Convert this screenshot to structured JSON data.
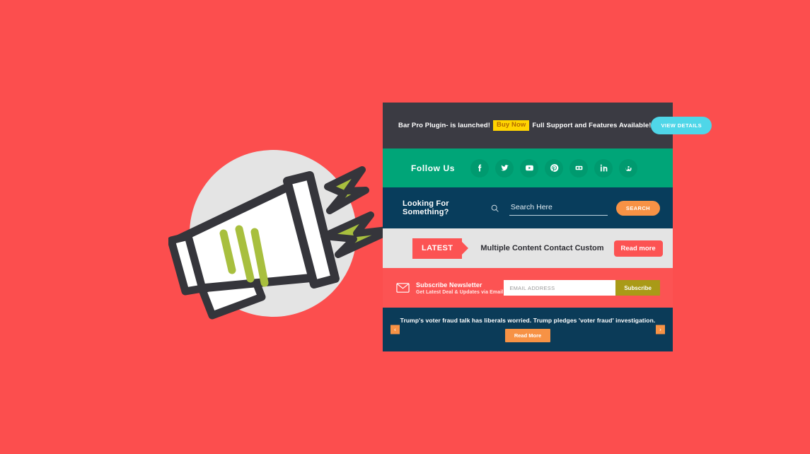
{
  "page": {
    "background_color": "#fc4e4e"
  },
  "illustration": {
    "name": "megaphone-announcement",
    "circle_color": "#e4e4e4",
    "outline_color": "#35353b",
    "body_color": "#ffffff",
    "accent_color": "#a8bf3e"
  },
  "promo_bar": {
    "background_color": "#3b3b43",
    "text_before": "Bar Pro Plugin- is launched!",
    "buy_now_label": "Buy Now",
    "buy_now_bg": "#ffd400",
    "text_after": "Full Support and Features Available!",
    "button_label": "VIEW DETAILS",
    "button_bg": "#4fd6e8"
  },
  "follow_bar": {
    "background_color": "#00a578",
    "label": "Follow Us",
    "socials": [
      {
        "name": "facebook-icon",
        "title": "Facebook"
      },
      {
        "name": "twitter-icon",
        "title": "Twitter"
      },
      {
        "name": "youtube-icon",
        "title": "YouTube"
      },
      {
        "name": "pinterest-icon",
        "title": "Pinterest"
      },
      {
        "name": "flickr-icon",
        "title": "Flickr"
      },
      {
        "name": "linkedin-icon",
        "title": "LinkedIn"
      },
      {
        "name": "stumbleupon-icon",
        "title": "StumbleUpon"
      }
    ]
  },
  "search_bar": {
    "background_color": "#083d5c",
    "label": "Looking For Something?",
    "input_placeholder": "Search Here",
    "input_value": "",
    "button_label": "SEARCH",
    "button_bg": "#f79245"
  },
  "latest_bar": {
    "background_color": "#e4e4e4",
    "badge_label": "LATEST",
    "badge_bg": "#fc5353",
    "headline": "Multiple Content Contact Custom",
    "button_label": "Read more"
  },
  "subscribe_bar": {
    "background_color": "#fc5353",
    "title": "Subscribe Newsletter",
    "subtitle": "Get Latest Deal & Updates via Email",
    "input_placeholder": "EMAIL ADDRESS",
    "input_value": "",
    "button_label": "Subscribe",
    "button_bg": "#a99a17"
  },
  "news_bar": {
    "background_color": "#0b3b58",
    "headline": "Trump's voter fraud talk has liberals worried. Trump pledges 'voter fraud' investigation.",
    "button_label": "Read More",
    "button_bg": "#f79245",
    "prev_label": "‹",
    "next_label": "›"
  }
}
